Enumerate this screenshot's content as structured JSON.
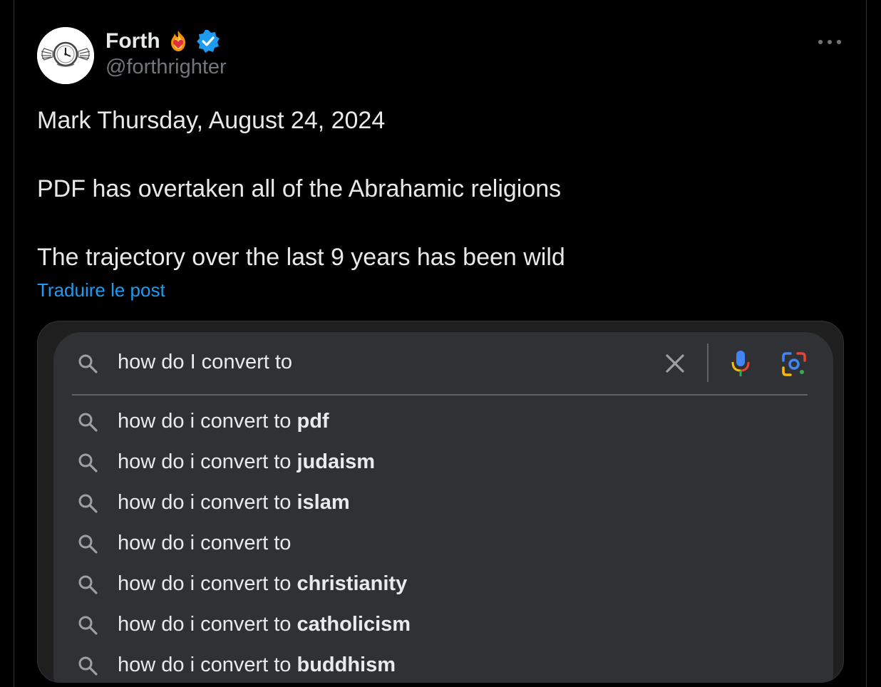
{
  "author": {
    "display_name": "Forth",
    "handle": "@forthrighter"
  },
  "tweet": {
    "lines": [
      "Mark Thursday, August 24, 2024",
      "PDF has overtaken all of the Abrahamic religions",
      "The trajectory over the last 9 years has been wild"
    ],
    "translate_label": "Traduire le post"
  },
  "search": {
    "query": "how do I convert to",
    "suggestions": [
      {
        "prefix": "how do i convert to ",
        "bold": "pdf"
      },
      {
        "prefix": "how do i convert to ",
        "bold": "judaism"
      },
      {
        "prefix": "how do i convert to ",
        "bold": "islam"
      },
      {
        "prefix": "how do i convert to",
        "bold": ""
      },
      {
        "prefix": "how do i convert to ",
        "bold": "christianity"
      },
      {
        "prefix": "how do i convert to ",
        "bold": "catholicism"
      },
      {
        "prefix": "how do i convert to ",
        "bold": "buddhism"
      }
    ]
  },
  "icons": {
    "avatar": "winged-clock-logo",
    "badge_emoji": "heart-on-fire-icon",
    "verified": "verified-badge-icon",
    "more": "more-dots-icon",
    "search": "search-icon",
    "clear": "close-icon",
    "voice": "microphone-icon",
    "lens": "camera-lens-icon"
  },
  "colors": {
    "background": "#000000",
    "text": "#e7e9ea",
    "muted": "#71767b",
    "link": "#1d9bf0",
    "verified": "#1d9bf0",
    "search_bg": "#303134"
  }
}
